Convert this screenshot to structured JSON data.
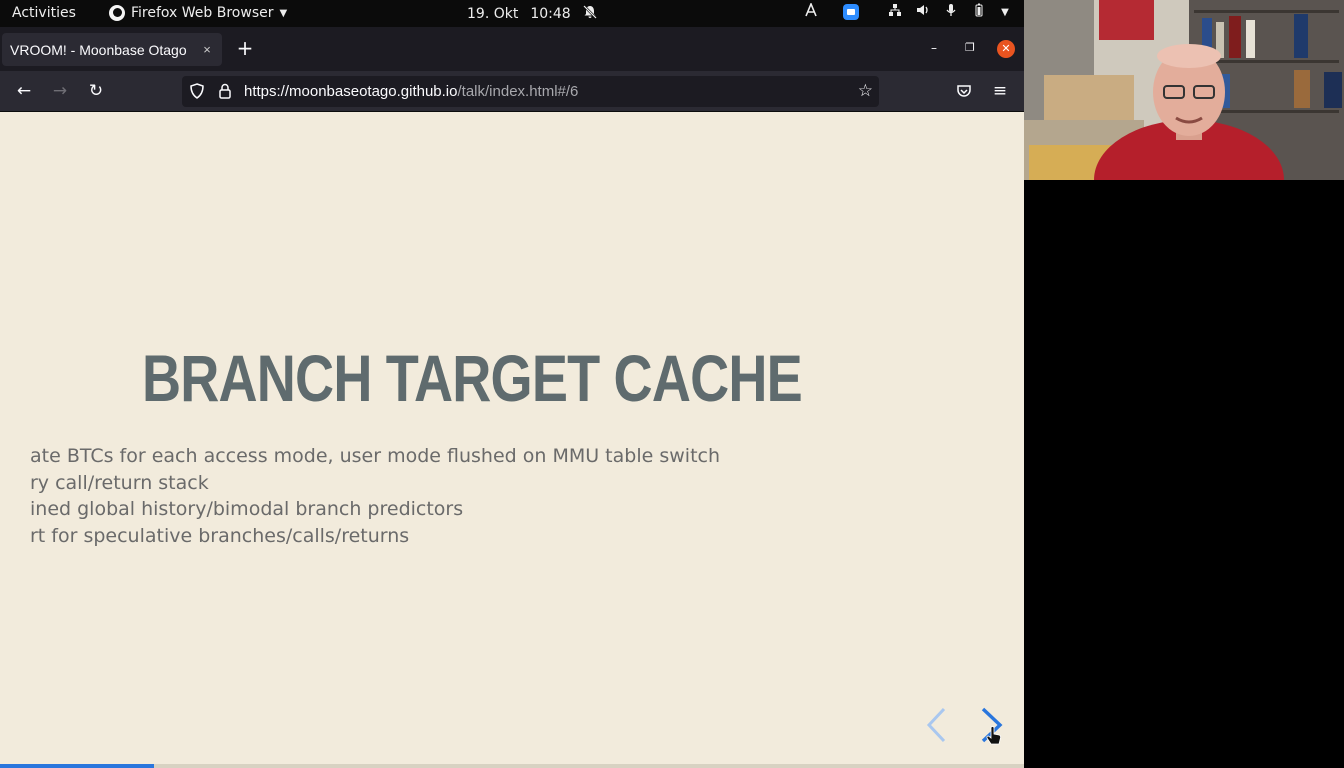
{
  "topbar": {
    "activities": "Activities",
    "app_name": "Firefox Web Browser",
    "date": "19. Okt",
    "time": "10:48",
    "tray_icons": [
      "accessibility-icon",
      "zoom-app-icon",
      "network-icon",
      "volume-icon",
      "microphone-icon",
      "battery-icon",
      "system-menu-caret-icon"
    ]
  },
  "browser": {
    "tab_title": "VROOM! - Moonbase Otago",
    "tab_close": "×",
    "new_tab": "+",
    "url_domain": "https://moonbaseotago.github.io",
    "url_path": "/talk/index.html#/6",
    "accent": "#e95420"
  },
  "slide": {
    "title": "BRANCH TARGET CACHE",
    "bullets": [
      "ate BTCs for each access mode, user mode flushed on MMU table switch",
      "ry call/return stack",
      "ined global history/bimodal branch predictors",
      "rt for speculative branches/calls/returns"
    ],
    "background": "#f2ebdc",
    "title_color": "#5f6b6e",
    "progress_fraction": 0.15,
    "nav": {
      "prev_enabled": false,
      "next_enabled": true
    }
  },
  "webcam": {
    "description_icon": "presenter-webcam-feed"
  }
}
